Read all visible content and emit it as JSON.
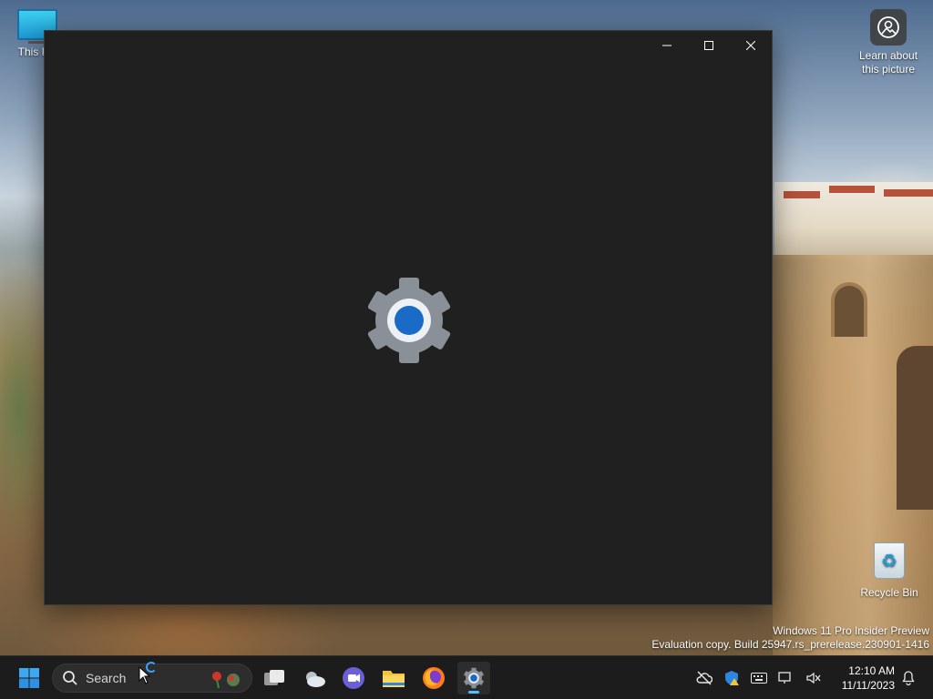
{
  "desktop": {
    "icons": [
      {
        "label": "This PC"
      },
      {
        "label": "Learn about this picture"
      },
      {
        "label": "Recycle Bin"
      }
    ],
    "watermark": {
      "line1": "Windows 11 Pro Insider Preview",
      "line2": "Evaluation copy. Build 25947.rs_prerelease.230901-1416"
    }
  },
  "window": {
    "app_icon": "settings-gear-icon",
    "controls": {
      "minimize": "─",
      "maximize": "☐",
      "close": "✕"
    }
  },
  "taskbar": {
    "search_placeholder": "Search",
    "apps": [
      "start-icon",
      "task-view-icon",
      "weather-widget-icon",
      "teams-chat-icon",
      "file-explorer-icon",
      "firefox-icon",
      "settings-icon"
    ],
    "active_app": "settings-icon",
    "tray": {
      "time": "12:10 AM",
      "date": "11/11/2023"
    }
  },
  "colors": {
    "window_bg": "#202020",
    "taskbar_bg": "#1c1c1c",
    "accent": "#4cc2ff",
    "gear_gray": "#8a9097",
    "gear_blue": "#1a6ac8"
  }
}
